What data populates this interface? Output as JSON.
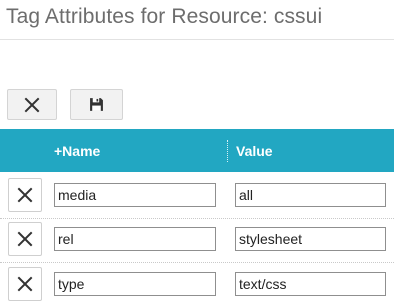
{
  "page": {
    "title": "Tag Attributes for Resource: cssui"
  },
  "toolbar": {
    "cancel_icon": "close-icon",
    "save_icon": "floppy-disk-icon"
  },
  "table": {
    "headers": {
      "name": "+Name",
      "value": "Value"
    },
    "rows": [
      {
        "name": "media",
        "value": "all"
      },
      {
        "name": "rel",
        "value": "stylesheet"
      },
      {
        "name": "type",
        "value": "text/css"
      }
    ]
  },
  "colors": {
    "header_bg": "#22a7c2",
    "title_text": "#6d6d6d",
    "icon": "#333333"
  }
}
